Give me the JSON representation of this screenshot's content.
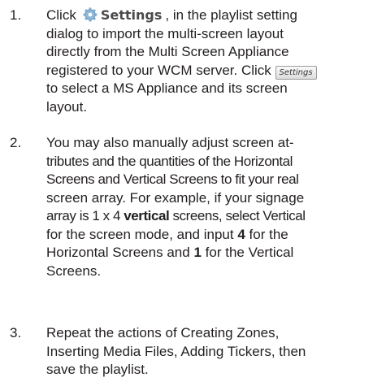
{
  "items": [
    {
      "number": "1.",
      "line1_prefix": "Click",
      "settings_label": "Settings",
      "line1_suffix": ", in the playlist setting",
      "lines": [
        "dialog  to import the multi-screen layout",
        "directly from the Multi Screen Appliance",
        "registered to your WCM server. Click"
      ],
      "button_label": "Settings",
      "lines_after": [
        "to select a MS Appliance and its screen",
        "layout."
      ]
    },
    {
      "number": "2.",
      "lines": [
        "You may also manually adjust screen at-",
        "tributes and the quantities of the Horizontal",
        "Screens and Vertical Screens to fit your real",
        "screen array. For example, if your signage"
      ],
      "line5_prefix": "array is 1 x 4",
      "line5_bold": "vertical",
      "line5_suffix": "screens, select Vertical",
      "line6_prefix": "for the screen mode, and input",
      "line6_bold": "4",
      "line6_suffix": "for the",
      "line7_prefix": "Horizontal Screens and",
      "line7_bold": "1",
      "line7_suffix": "for the Vertical",
      "line8": "Screens."
    },
    {
      "number": "3.",
      "lines": [
        "Repeat the actions of Creating Zones,",
        "Inserting Media Files, Adding Tickers, then",
        "save the playlist."
      ]
    }
  ],
  "icons": {
    "gear": "settings-gear-icon"
  }
}
